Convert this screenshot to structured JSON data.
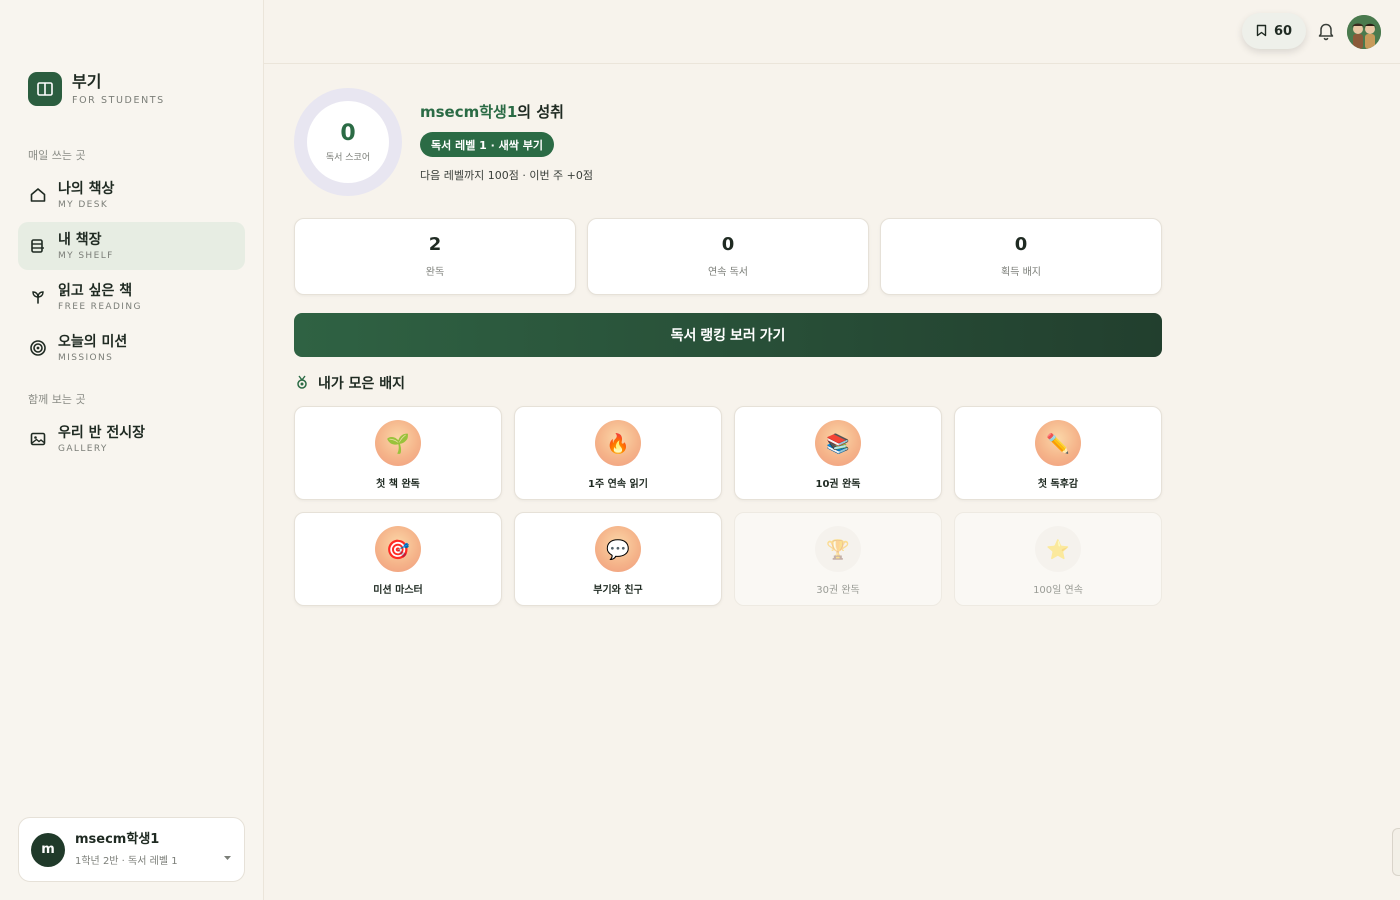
{
  "brand": {
    "name": "부기",
    "sub": "FOR STUDENTS"
  },
  "sidebar": {
    "section1": "매일 쓰는 곳",
    "section2": "함께 보는 곳",
    "items": [
      {
        "label": "나의 책상",
        "sub": "MY DESK",
        "icon": "home-icon",
        "active": false
      },
      {
        "label": "내 책장",
        "sub": "MY SHELF",
        "icon": "shelf-icon",
        "active": true
      },
      {
        "label": "읽고 싶은 책",
        "sub": "FREE READING",
        "icon": "sprout-icon",
        "active": false
      },
      {
        "label": "오늘의 미션",
        "sub": "MISSIONS",
        "icon": "target-icon",
        "active": false
      },
      {
        "label": "우리 반 전시장",
        "sub": "GALLERY",
        "icon": "image-icon",
        "active": false
      }
    ]
  },
  "user": {
    "initial": "m",
    "name": "msecm학생1",
    "meta": "1학년 2반 · 독서 레벨 1"
  },
  "topbar": {
    "points": "60"
  },
  "achievement": {
    "score": "0",
    "score_label": "독서 스코어",
    "user_name": "msecm학생1",
    "title_suffix": "의 성취",
    "level_badge": "독서 레벨 1 · 새싹 부기",
    "next_level": "다음 레벨까지 100점 · 이번 주 +0점"
  },
  "stats": [
    {
      "value": "2",
      "label": "완독"
    },
    {
      "value": "0",
      "label": "연속 독서"
    },
    {
      "value": "0",
      "label": "획득 배지"
    }
  ],
  "ranking_button": "독서 랭킹 보러 가기",
  "badges": {
    "title": "내가 모은 배지",
    "items": [
      {
        "name": "첫 책 완독",
        "glyph": "🌱",
        "locked": false
      },
      {
        "name": "1주 연속 읽기",
        "glyph": "🔥",
        "locked": false
      },
      {
        "name": "10권 완독",
        "glyph": "📚",
        "locked": false
      },
      {
        "name": "첫 독후감",
        "glyph": "✏️",
        "locked": false
      },
      {
        "name": "미션 마스터",
        "glyph": "🎯",
        "locked": false
      },
      {
        "name": "부기와 친구",
        "glyph": "💬",
        "locked": false
      },
      {
        "name": "30권 완독",
        "glyph": "🏆",
        "locked": true
      },
      {
        "name": "100일 연속",
        "glyph": "⭐",
        "locked": true
      }
    ]
  },
  "colors": {
    "accent": "#2b6b45",
    "background": "#f7f3ec",
    "badge_gradient": "#f5b48a"
  }
}
